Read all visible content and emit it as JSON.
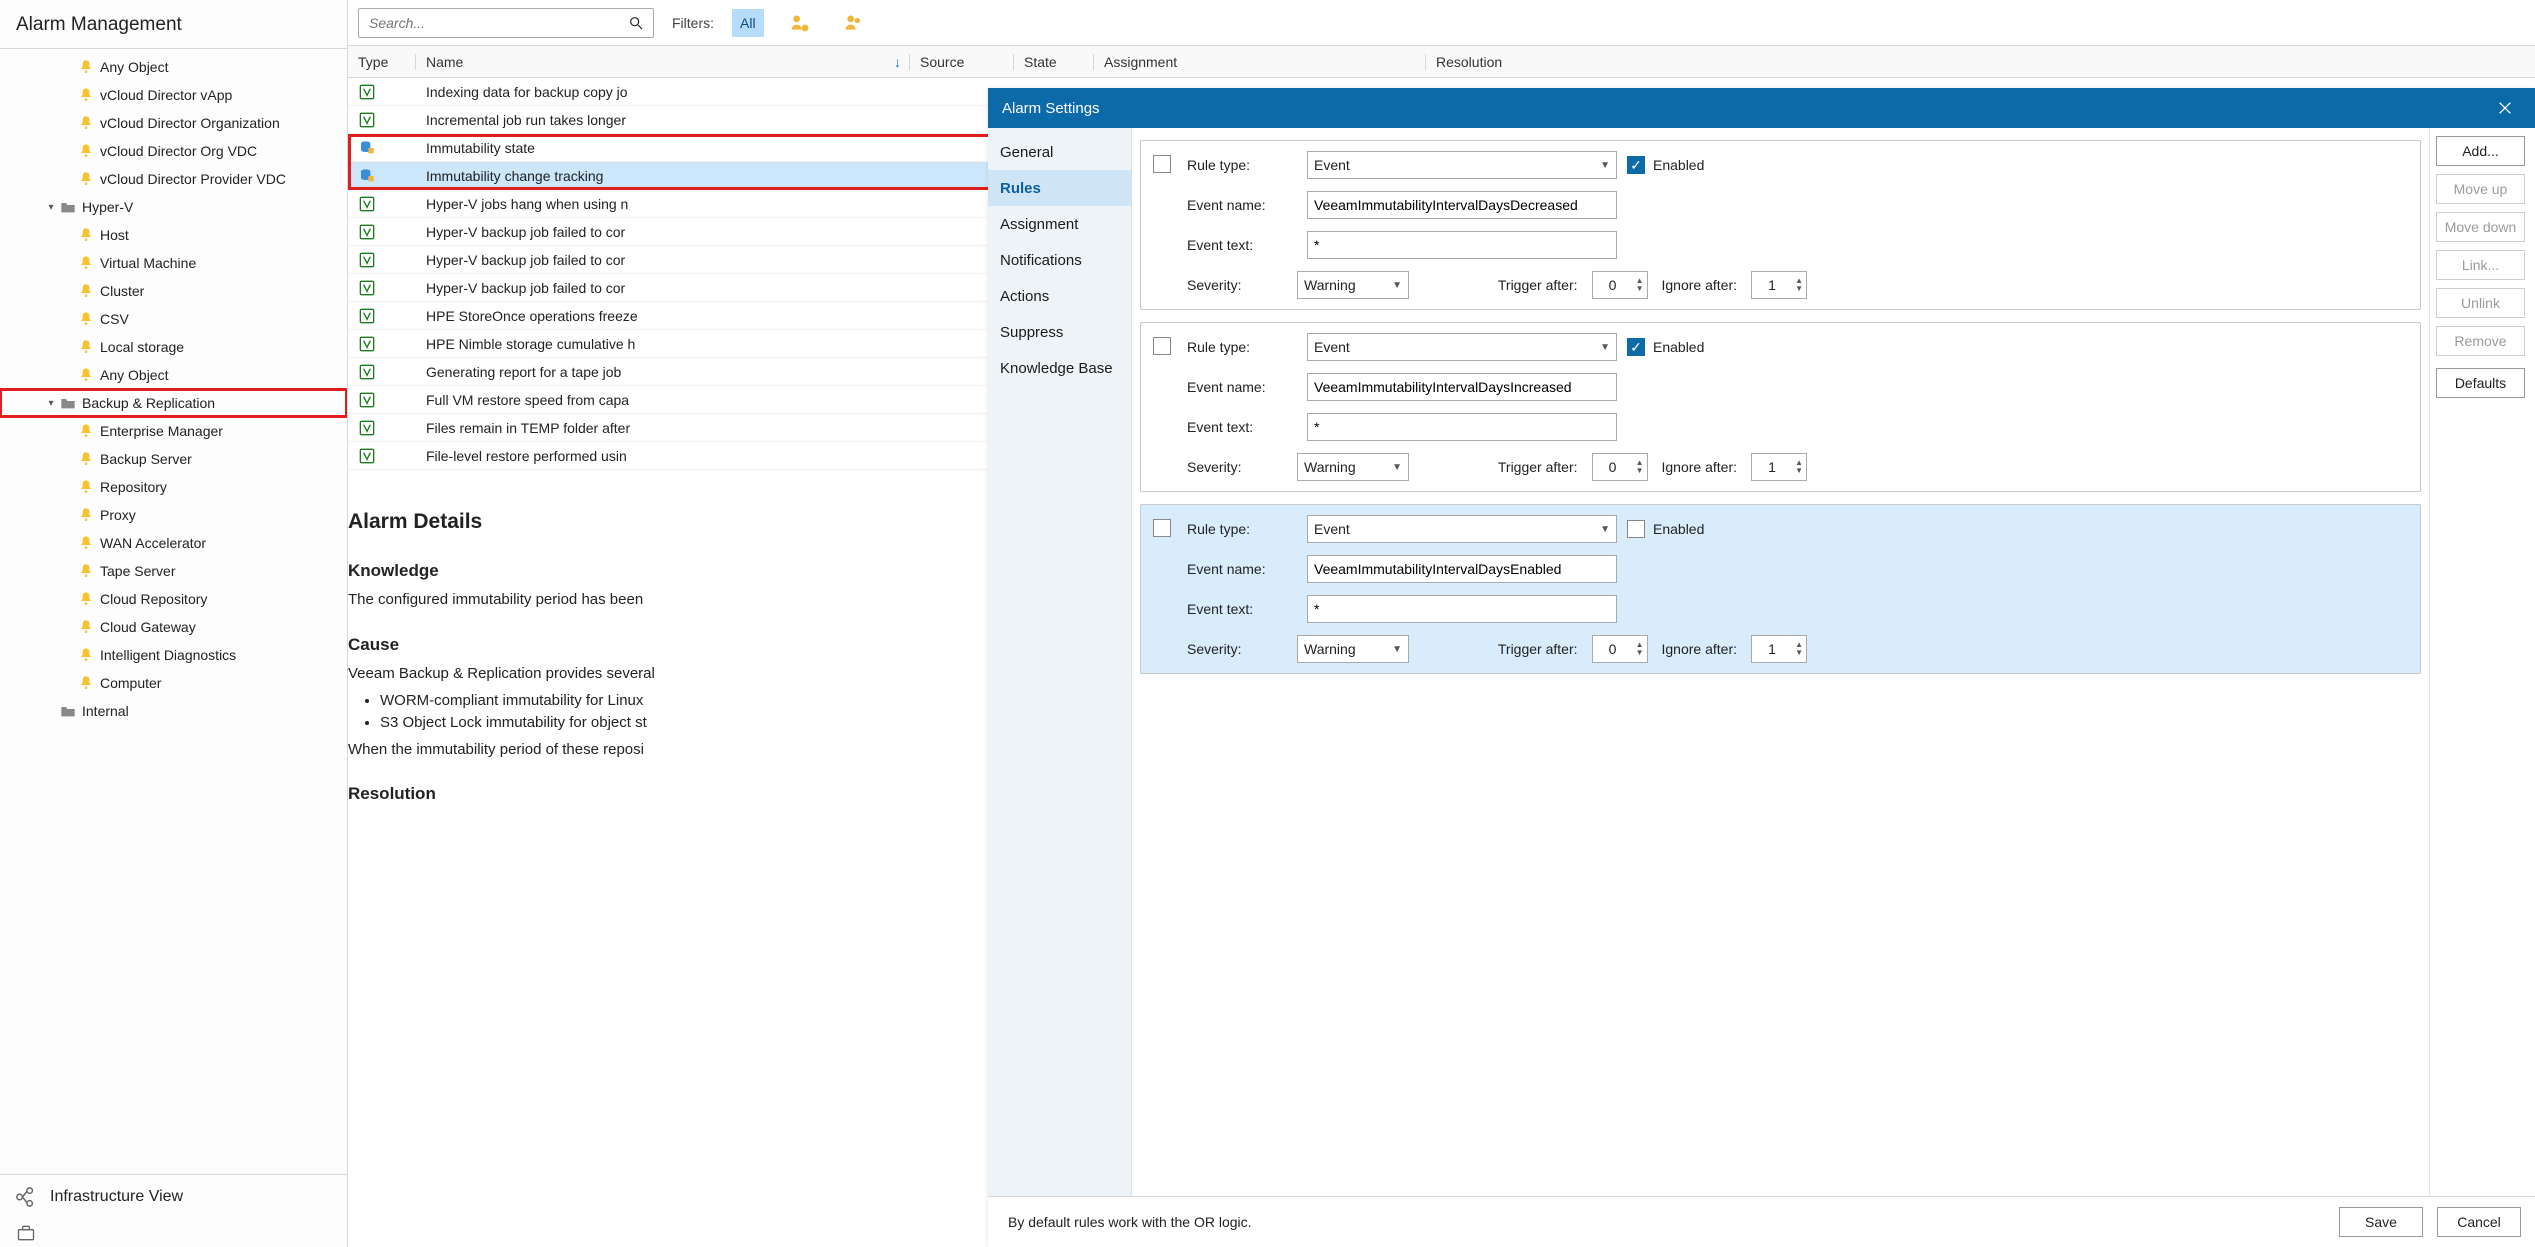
{
  "sidebar": {
    "title": "Alarm Management",
    "items": [
      {
        "label": "Any Object",
        "indent": 3,
        "chevron": "",
        "folder": false,
        "hi": false
      },
      {
        "label": "vCloud Director vApp",
        "indent": 3,
        "chevron": "",
        "folder": false,
        "hi": false
      },
      {
        "label": "vCloud Director Organization",
        "indent": 3,
        "chevron": "",
        "folder": false,
        "hi": false
      },
      {
        "label": "vCloud Director Org VDC",
        "indent": 3,
        "chevron": "",
        "folder": false,
        "hi": false
      },
      {
        "label": "vCloud Director Provider VDC",
        "indent": 3,
        "chevron": "",
        "folder": false,
        "hi": false
      },
      {
        "label": "Hyper-V",
        "indent": 2,
        "chevron": "▾",
        "folder": true,
        "hi": false
      },
      {
        "label": "Host",
        "indent": 3,
        "chevron": "",
        "folder": false,
        "hi": false
      },
      {
        "label": "Virtual Machine",
        "indent": 3,
        "chevron": "",
        "folder": false,
        "hi": false
      },
      {
        "label": "Cluster",
        "indent": 3,
        "chevron": "",
        "folder": false,
        "hi": false
      },
      {
        "label": "CSV",
        "indent": 3,
        "chevron": "",
        "folder": false,
        "hi": false
      },
      {
        "label": "Local storage",
        "indent": 3,
        "chevron": "",
        "folder": false,
        "hi": false
      },
      {
        "label": "Any Object",
        "indent": 3,
        "chevron": "",
        "folder": false,
        "hi": false
      },
      {
        "label": "Backup & Replication",
        "indent": 2,
        "chevron": "▾",
        "folder": true,
        "hi": true
      },
      {
        "label": "Enterprise Manager",
        "indent": 3,
        "chevron": "",
        "folder": false,
        "hi": false
      },
      {
        "label": "Backup Server",
        "indent": 3,
        "chevron": "",
        "folder": false,
        "hi": false
      },
      {
        "label": "Repository",
        "indent": 3,
        "chevron": "",
        "folder": false,
        "hi": false
      },
      {
        "label": "Proxy",
        "indent": 3,
        "chevron": "",
        "folder": false,
        "hi": false
      },
      {
        "label": "WAN Accelerator",
        "indent": 3,
        "chevron": "",
        "folder": false,
        "hi": false
      },
      {
        "label": "Tape Server",
        "indent": 3,
        "chevron": "",
        "folder": false,
        "hi": false
      },
      {
        "label": "Cloud Repository",
        "indent": 3,
        "chevron": "",
        "folder": false,
        "hi": false
      },
      {
        "label": "Cloud Gateway",
        "indent": 3,
        "chevron": "",
        "folder": false,
        "hi": false
      },
      {
        "label": "Intelligent Diagnostics",
        "indent": 3,
        "chevron": "",
        "folder": false,
        "hi": false
      },
      {
        "label": "Computer",
        "indent": 3,
        "chevron": "",
        "folder": false,
        "hi": false
      },
      {
        "label": "Internal",
        "indent": 2,
        "chevron": "",
        "folder": true,
        "hi": false
      }
    ],
    "bottom": {
      "infra": "Infrastructure View"
    }
  },
  "toolbar": {
    "search_placeholder": "Search...",
    "filters_label": "Filters:",
    "all_label": "All"
  },
  "columns": {
    "type": "Type",
    "name": "Name",
    "source": "Source",
    "state": "State",
    "assignment": "Assignment",
    "resolution": "Resolution"
  },
  "rows": [
    {
      "name": "Indexing data for backup copy jo",
      "type": "v",
      "sel": false,
      "group": "a"
    },
    {
      "name": "Incremental job run takes longer",
      "type": "v",
      "sel": false,
      "group": "a"
    },
    {
      "name": "Immutability state",
      "type": "db",
      "sel": false,
      "group": "b"
    },
    {
      "name": "Immutability change tracking",
      "type": "db",
      "sel": true,
      "group": "b"
    },
    {
      "name": "Hyper-V jobs hang when using n",
      "type": "v",
      "sel": false,
      "group": "c"
    },
    {
      "name": "Hyper-V backup job failed to cor",
      "type": "v",
      "sel": false,
      "group": "c"
    },
    {
      "name": "Hyper-V backup job failed to cor",
      "type": "v",
      "sel": false,
      "group": "c"
    },
    {
      "name": "Hyper-V backup job failed to cor",
      "type": "v",
      "sel": false,
      "group": "c"
    },
    {
      "name": "HPE StoreOnce operations freeze",
      "type": "v",
      "sel": false,
      "group": "c"
    },
    {
      "name": "HPE Nimble storage cumulative h",
      "type": "v",
      "sel": false,
      "group": "c"
    },
    {
      "name": "Generating report for a tape job",
      "type": "v",
      "sel": false,
      "group": "c"
    },
    {
      "name": "Full VM restore speed from capa",
      "type": "v",
      "sel": false,
      "group": "c"
    },
    {
      "name": "Files remain in TEMP folder after",
      "type": "v",
      "sel": false,
      "group": "c"
    },
    {
      "name": "File-level restore performed usin",
      "type": "v",
      "sel": false,
      "group": "c"
    }
  ],
  "details": {
    "title": "Alarm Details",
    "knowledge_h": "Knowledge",
    "knowledge_t": "The configured immutability period has been",
    "cause_h": "Cause",
    "cause_t": "Veeam Backup & Replication provides several",
    "bullets": [
      "WORM-compliant immutability for Linux",
      "S3 Object Lock immutability for object st"
    ],
    "post": "When the immutability period of these reposi",
    "resolution_h": "Resolution"
  },
  "dialog": {
    "title": "Alarm Settings",
    "nav": [
      "General",
      "Rules",
      "Assignment",
      "Notifications",
      "Actions",
      "Suppress",
      "Knowledge Base"
    ],
    "nav_selected": 1,
    "note": "By default rules work with the OR logic.",
    "buttons": {
      "save": "Save",
      "cancel": "Cancel",
      "add": "Add...",
      "moveup": "Move up",
      "movedown": "Move down",
      "link": "Link...",
      "unlink": "Unlink",
      "remove": "Remove",
      "defaults": "Defaults"
    },
    "field_labels": {
      "rule_type": "Rule type:",
      "event_name": "Event name:",
      "event_text": "Event text:",
      "severity": "Severity:",
      "enabled": "Enabled",
      "trigger_after": "Trigger after:",
      "ignore_after": "Ignore after:"
    },
    "rules": [
      {
        "type": "Event",
        "enabled": true,
        "event_name": "VeeamImmutabilityIntervalDaysDecreased",
        "event_text": "*",
        "severity": "Warning",
        "trigger_after": 0,
        "ignore_after": 1,
        "sel": false
      },
      {
        "type": "Event",
        "enabled": true,
        "event_name": "VeeamImmutabilityIntervalDaysIncreased",
        "event_text": "*",
        "severity": "Warning",
        "trigger_after": 0,
        "ignore_after": 1,
        "sel": false
      },
      {
        "type": "Event",
        "enabled": false,
        "event_name": "VeeamImmutabilityIntervalDaysEnabled",
        "event_text": "*",
        "severity": "Warning",
        "trigger_after": 0,
        "ignore_after": 1,
        "sel": true
      }
    ]
  }
}
